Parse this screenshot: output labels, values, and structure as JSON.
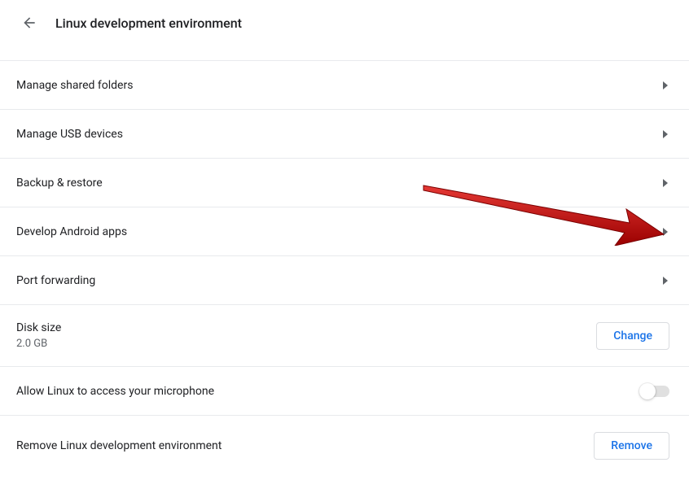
{
  "header": {
    "title": "Linux development environment"
  },
  "rows": {
    "sharedFolders": "Manage shared folders",
    "usbDevices": "Manage USB devices",
    "backupRestore": "Backup & restore",
    "androidApps": "Develop Android apps",
    "portForwarding": "Port forwarding",
    "diskSizeLabel": "Disk size",
    "diskSizeValue": "2.0 GB",
    "microphone": "Allow Linux to access your microphone",
    "removeEnv": "Remove Linux development environment"
  },
  "buttons": {
    "change": "Change",
    "remove": "Remove"
  }
}
